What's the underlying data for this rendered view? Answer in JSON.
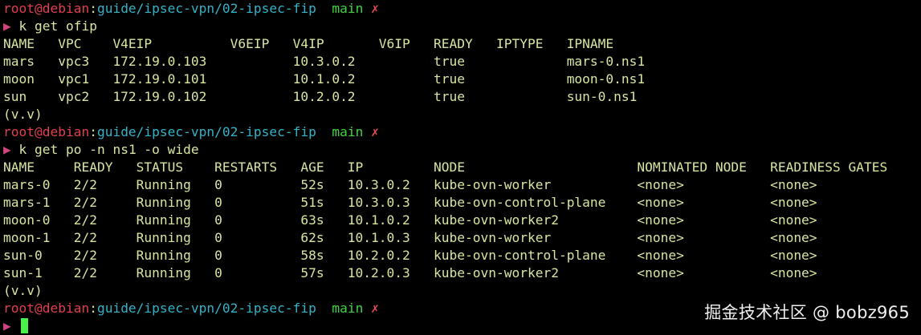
{
  "colors": {
    "background": "#000000",
    "text": "#d6e6a0",
    "user_host": "#e0414f",
    "path": "#34b3c8",
    "branch": "#3fd53f",
    "dirty_mark": "#e04b52",
    "prompt_arrow": "#d1447d",
    "cursor": "#4cf04c"
  },
  "prompts": [
    {
      "user_host": "root@debian",
      "sep": ":",
      "path": "guide/ipsec-vpn/02-ipsec-fip",
      "branch": "main",
      "dirty": "✗"
    },
    {
      "user_host": "root@debian",
      "sep": ":",
      "path": "guide/ipsec-vpn/02-ipsec-fip",
      "branch": "main",
      "dirty": "✗"
    },
    {
      "user_host": "root@debian",
      "sep": ":",
      "path": "guide/ipsec-vpn/02-ipsec-fip",
      "branch": "main",
      "dirty": "✗"
    }
  ],
  "commands": [
    {
      "arrow": "▶",
      "text": "k get ofip"
    },
    {
      "arrow": "▶",
      "text": "k get po -n ns1 -o wide"
    },
    {
      "arrow": "▶",
      "text": ""
    }
  ],
  "ofip_table": {
    "header": "NAME   VPC    V4EIP          V6EIP   V4IP       V6IP   READY   IPTYPE   IPNAME",
    "rows": [
      "mars   vpc3   172.19.0.103           10.3.0.2          true             mars-0.ns1",
      "moon   vpc1   172.19.0.101           10.1.0.2          true             moon-0.ns1",
      "sun    vpc2   172.19.0.102           10.2.0.2          true             sun-0.ns1"
    ]
  },
  "pod_table": {
    "header": "NAME     READY   STATUS    RESTARTS   AGE   IP         NODE                      NOMINATED NODE   READINESS GATES",
    "rows": [
      "mars-0   2/2     Running   0          52s   10.3.0.2   kube-ovn-worker           <none>           <none>",
      "mars-1   2/2     Running   0          51s   10.3.0.3   kube-ovn-control-plane    <none>           <none>",
      "moon-0   2/2     Running   0          63s   10.1.0.2   kube-ovn-worker2          <none>           <none>",
      "moon-1   2/2     Running   0          62s   10.1.0.3   kube-ovn-worker           <none>           <none>",
      "sun-0    2/2     Running   0          58s   10.2.0.2   kube-ovn-control-plane    <none>           <none>",
      "sun-1    2/2     Running   0          57s   10.2.0.3   kube-ovn-worker2          <none>           <none>"
    ]
  },
  "rprompts": [
    "(v.v)",
    "(v.v)"
  ],
  "watermark": "掘金技术社区 @ bobz965"
}
